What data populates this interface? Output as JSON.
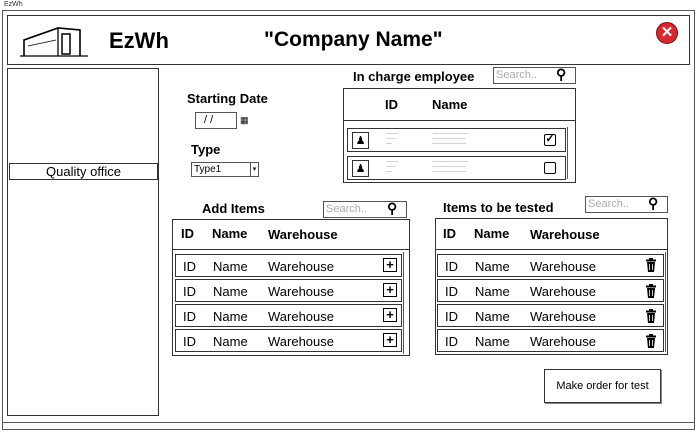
{
  "window": {
    "title": "EzWh"
  },
  "header": {
    "app_name": "EzWh",
    "company_name": "\"Company Name\"",
    "close_icon": "close-icon"
  },
  "sidebar": {
    "quality_office_label": "Quality office"
  },
  "form": {
    "starting_date_label": "Starting Date",
    "date_value": "/ /",
    "type_label": "Type",
    "type_value": "Type1"
  },
  "employee_panel": {
    "title": "In charge employee",
    "search_placeholder": "Search..",
    "columns": [
      "ID",
      "Name"
    ],
    "rows": [
      {
        "checked": true
      },
      {
        "checked": false
      }
    ]
  },
  "add_items": {
    "title": "Add Items",
    "search_placeholder": "Search..",
    "columns": [
      "ID",
      "Name",
      "Warehouse"
    ],
    "rows": [
      {
        "id": "ID",
        "name": "Name",
        "warehouse": "Warehouse"
      },
      {
        "id": "ID",
        "name": "Name",
        "warehouse": "Warehouse"
      },
      {
        "id": "ID",
        "name": "Name",
        "warehouse": "Warehouse"
      },
      {
        "id": "ID",
        "name": "Name",
        "warehouse": "Warehouse"
      }
    ]
  },
  "tested_items": {
    "title": "Items to be tested",
    "search_placeholder": "Search..",
    "columns": [
      "ID",
      "Name",
      "Warehouse"
    ],
    "rows": [
      {
        "id": "ID",
        "name": "Name",
        "warehouse": "Warehouse"
      },
      {
        "id": "ID",
        "name": "Name",
        "warehouse": "Warehouse"
      },
      {
        "id": "ID",
        "name": "Name",
        "warehouse": "Warehouse"
      },
      {
        "id": "ID",
        "name": "Name",
        "warehouse": "Warehouse"
      }
    ]
  },
  "actions": {
    "make_order_label": "Make order for test"
  },
  "colors": {
    "close_red": "#d6282e"
  }
}
